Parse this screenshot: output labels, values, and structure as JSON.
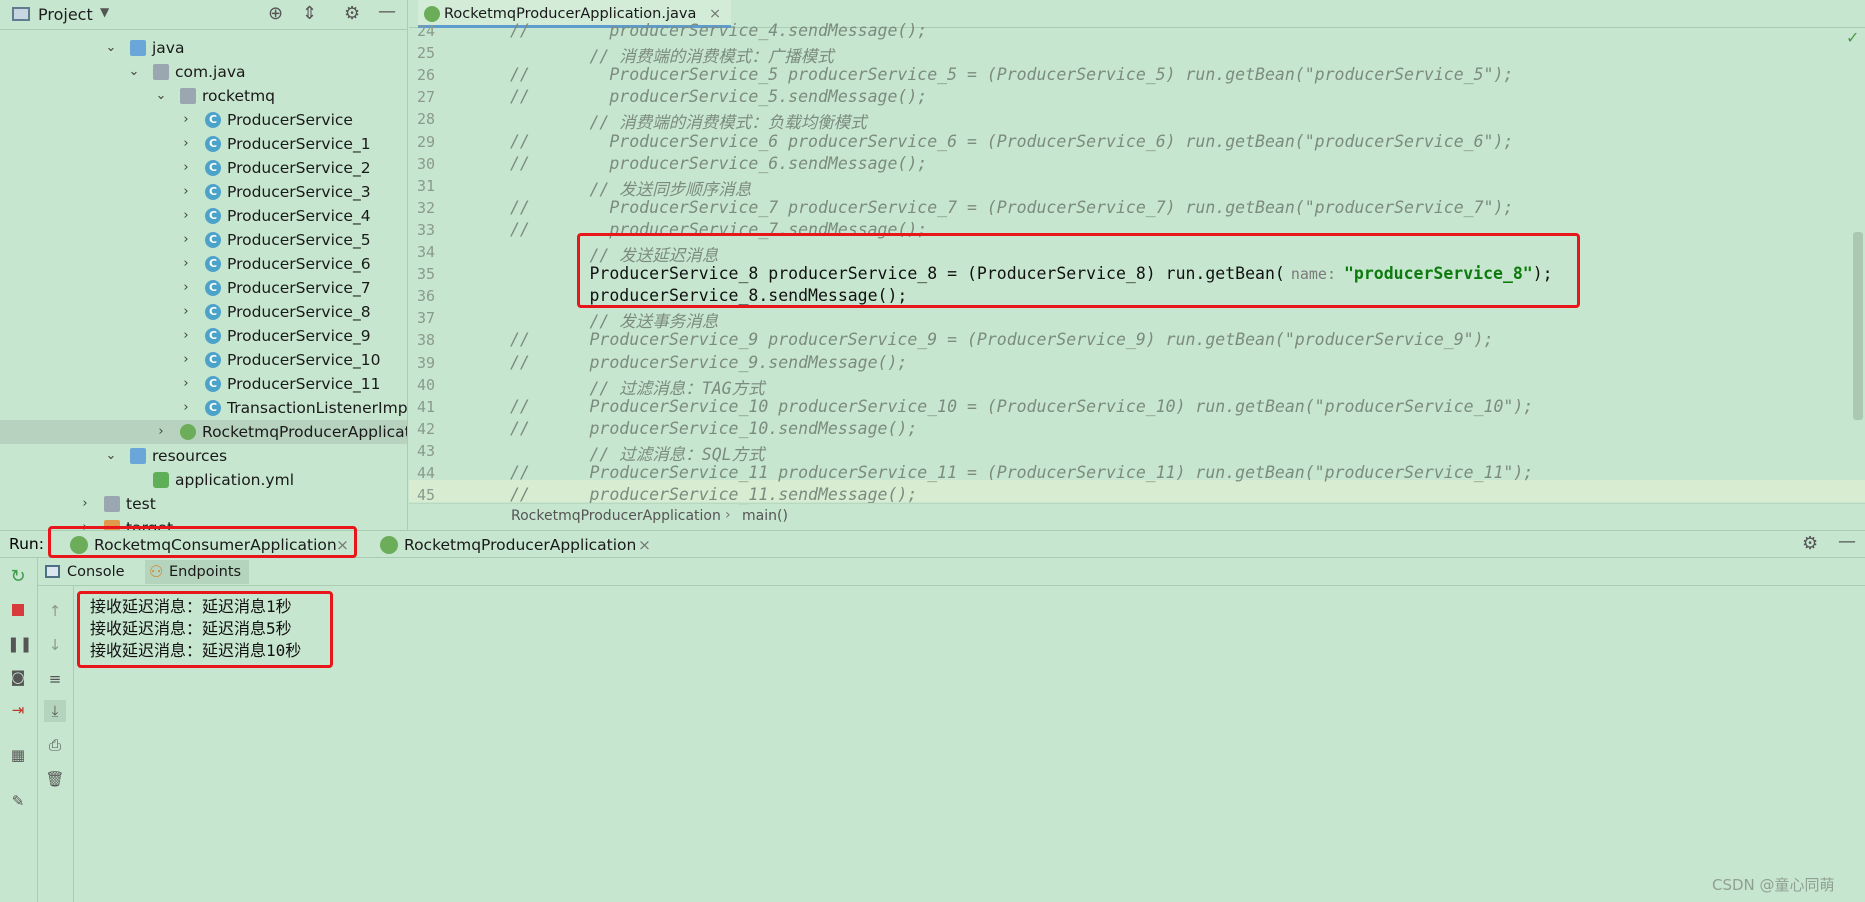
{
  "project_panel": {
    "title": "Project",
    "tree": [
      {
        "label": "java",
        "kind": "folder",
        "level": 1
      },
      {
        "label": "com.java",
        "kind": "package",
        "level": 2
      },
      {
        "label": "rocketmq",
        "kind": "package",
        "level": 3
      },
      {
        "label": "ProducerService",
        "kind": "class",
        "level": 4
      },
      {
        "label": "ProducerService_1",
        "kind": "class",
        "level": 4
      },
      {
        "label": "ProducerService_2",
        "kind": "class",
        "level": 4
      },
      {
        "label": "ProducerService_3",
        "kind": "class",
        "level": 4
      },
      {
        "label": "ProducerService_4",
        "kind": "class",
        "level": 4
      },
      {
        "label": "ProducerService_5",
        "kind": "class",
        "level": 4
      },
      {
        "label": "ProducerService_6",
        "kind": "class",
        "level": 4
      },
      {
        "label": "ProducerService_7",
        "kind": "class",
        "level": 4
      },
      {
        "label": "ProducerService_8",
        "kind": "class",
        "level": 4
      },
      {
        "label": "ProducerService_9",
        "kind": "class",
        "level": 4
      },
      {
        "label": "ProducerService_10",
        "kind": "class",
        "level": 4
      },
      {
        "label": "ProducerService_11",
        "kind": "class",
        "level": 4
      },
      {
        "label": "TransactionListenerImpl",
        "kind": "class",
        "level": 4
      },
      {
        "label": "RocketmqProducerApplicati",
        "kind": "spring",
        "level": 3
      },
      {
        "label": "resources",
        "kind": "folder",
        "level": 1
      },
      {
        "label": "application.yml",
        "kind": "yml",
        "level": 2
      },
      {
        "label": "test",
        "kind": "folder-grey",
        "level": 0
      },
      {
        "label": "target",
        "kind": "folder-orange",
        "level": 0
      }
    ]
  },
  "editor": {
    "tab_label": "RocketmqProducerApplication.java",
    "lines": [
      {
        "n": "24",
        "text": "//        producerService_4.sendMessage();",
        "active": false
      },
      {
        "n": "25",
        "text": "        // 消费端的消费模式：广播模式",
        "active": false
      },
      {
        "n": "26",
        "text": "//        ProducerService_5 producerService_5 = (ProducerService_5) run.getBean(\"producerService_5\");",
        "active": false
      },
      {
        "n": "27",
        "text": "//        producerService_5.sendMessage();",
        "active": false
      },
      {
        "n": "28",
        "text": "        // 消费端的消费模式：负载均衡模式",
        "active": false
      },
      {
        "n": "29",
        "text": "//        ProducerService_6 producerService_6 = (ProducerService_6) run.getBean(\"producerService_6\");",
        "active": false
      },
      {
        "n": "30",
        "text": "//        producerService_6.sendMessage();",
        "active": false
      },
      {
        "n": "31",
        "text": "        // 发送同步顺序消息",
        "active": false
      },
      {
        "n": "32",
        "text": "//        ProducerService_7 producerService_7 = (ProducerService_7) run.getBean(\"producerService_7\");",
        "active": false
      },
      {
        "n": "33",
        "text": "//        producerService_7.sendMessage();",
        "active": false
      },
      {
        "n": "34",
        "text": "        // 发送延迟消息",
        "active": false
      },
      {
        "n": "35",
        "text": "        ProducerService_8 producerService_8 = (ProducerService_8) run.getBean(",
        "active": true
      },
      {
        "n": "36",
        "text": "        producerService_8.sendMessage();",
        "active": true
      },
      {
        "n": "37",
        "text": "        // 发送事务消息",
        "active": false
      },
      {
        "n": "38",
        "text": "//      ProducerService_9 producerService_9 = (ProducerService_9) run.getBean(\"producerService_9\");",
        "active": false
      },
      {
        "n": "39",
        "text": "//      producerService_9.sendMessage();",
        "active": false
      },
      {
        "n": "40",
        "text": "        // 过滤消息：TAG方式",
        "active": false
      },
      {
        "n": "41",
        "text": "//      ProducerService_10 producerService_10 = (ProducerService_10) run.getBean(\"producerService_10\");",
        "active": false
      },
      {
        "n": "42",
        "text": "//      producerService_10.sendMessage();",
        "active": false
      },
      {
        "n": "43",
        "text": "        // 过滤消息：SQL方式",
        "active": false
      },
      {
        "n": "44",
        "text": "//      ProducerService_11 producerService_11 = (ProducerService_11) run.getBean(\"producerService_11\");",
        "active": false
      },
      {
        "n": "45",
        "text": "//      producerService_11.sendMessage();",
        "active": false
      }
    ],
    "line35_hint": "name:",
    "line35_string": "\"producerService_8\"",
    "line35_end": ");",
    "breadcrumb": [
      "RocketmqProducerApplication",
      "main()"
    ]
  },
  "run": {
    "label": "Run:",
    "tabs": [
      "RocketmqConsumerApplication",
      "RocketmqProducerApplication"
    ],
    "sub_tabs": [
      "Console",
      "Endpoints"
    ],
    "console_lines": [
      "接收延迟消息：延迟消息1秒",
      "接收延迟消息：延迟消息5秒",
      "接收延迟消息：延迟消息10秒"
    ]
  },
  "watermark": "CSDN @童心同萌",
  "colors": {
    "highlight_box": "#e8161b",
    "background": "#c7e6cf",
    "string": "#0c7a0c"
  }
}
